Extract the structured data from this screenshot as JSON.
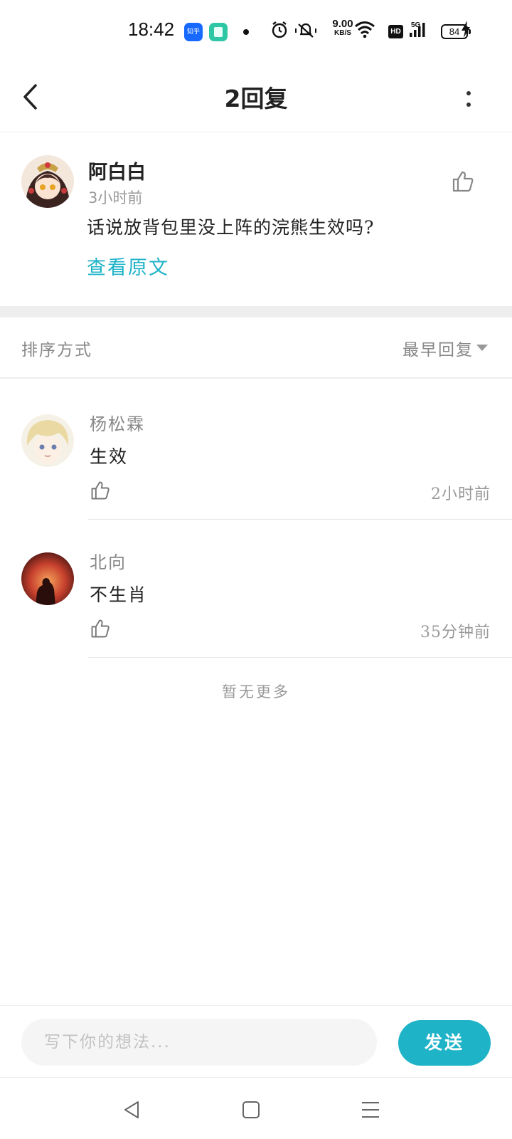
{
  "status_bar": {
    "time": "18:42",
    "app_icon_1_label": "知乎",
    "net_speed_value": "9.00",
    "net_speed_unit": "KB/S",
    "hd_label": "HD",
    "network_label": "5G",
    "battery": "84"
  },
  "header": {
    "title": "2回复",
    "back_icon": "chevron-left-icon",
    "more_icon": "vertical-dots-icon"
  },
  "post": {
    "author": "阿白白",
    "time": "3小时前",
    "text": "话说放背包里没上阵的浣熊生效吗?",
    "view_original": "查看原文",
    "like_icon": "thumbs-up-icon"
  },
  "sort": {
    "label": "排序方式",
    "selected": "最早回复"
  },
  "replies": [
    {
      "author": "杨松霖",
      "text": "生效",
      "time": "2小时前"
    },
    {
      "author": "北向",
      "text": "不生肖",
      "time": "35分钟前"
    }
  ],
  "no_more": "暂无更多",
  "composer": {
    "placeholder": "写下你的想法...",
    "send_label": "发送"
  },
  "colors": {
    "accent": "#1fb3c8",
    "separator": "#eeeeee"
  }
}
